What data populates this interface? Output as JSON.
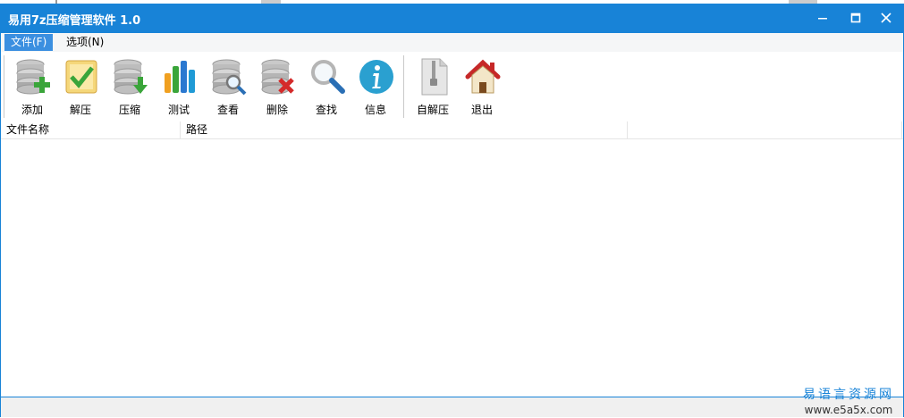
{
  "window": {
    "title": "易用7z压缩管理软件 1.0"
  },
  "menu": [
    {
      "label": "文件(F)",
      "active": true
    },
    {
      "label": "选项(N)",
      "active": false
    }
  ],
  "toolbar": [
    {
      "label": "添加",
      "icon": "add-archive-icon"
    },
    {
      "label": "解压",
      "icon": "extract-icon"
    },
    {
      "label": "压缩",
      "icon": "compress-icon"
    },
    {
      "label": "测试",
      "icon": "bar-chart-icon"
    },
    {
      "label": "查看",
      "icon": "view-icon"
    },
    {
      "label": "删除",
      "icon": "delete-icon"
    },
    {
      "label": "查找",
      "icon": "search-icon"
    },
    {
      "label": "信息",
      "icon": "info-icon"
    },
    {
      "label": "自解压",
      "icon": "zip-file-icon"
    },
    {
      "label": "退出",
      "icon": "home-icon"
    }
  ],
  "list": {
    "columns": [
      "文件名称",
      "路径",
      ""
    ]
  },
  "watermark": {
    "line1": "易语言资源网",
    "line2": "www.e5a5x.com"
  }
}
